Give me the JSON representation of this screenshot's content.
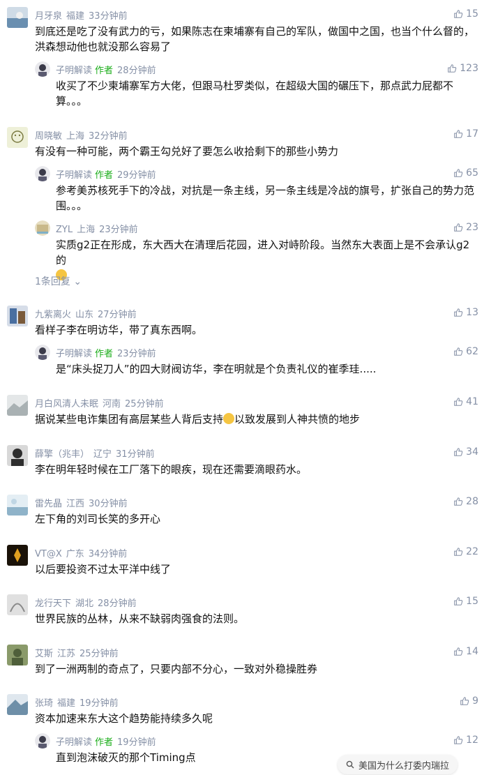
{
  "author_tag": "作者",
  "like_icon": "thumbs-up-icon",
  "comments": [
    {
      "name": "月牙泉",
      "loc": "福建",
      "time": "33分钟前",
      "text": "到底还是吃了没有武力的亏，如果陈志在柬埔寨有自己的军队，做国中之国，也当个什么督的，洪森想动他也就没那么容易了",
      "likes": "15",
      "avatar_color": "#6a8fb0"
    },
    {
      "name": "子明解读",
      "loc": "",
      "time": "28分钟前",
      "text": "收买了不少柬埔寨军方大佬，但跟马杜罗类似，在超级大国的碾压下，那点武力屁都不算。。。",
      "likes": "123",
      "avatar_color": "#3b3b4a"
    },
    {
      "name": "周晓敏",
      "loc": "上海",
      "time": "32分钟前",
      "text": "有没有一种可能，两个霸王勾兑好了要怎么收拾剩下的那些小势力",
      "likes": "17",
      "avatar_color": "#d9dcae"
    },
    {
      "name": "子明解读",
      "loc": "",
      "time": "29分钟前",
      "text": "参考美苏核死手下的冷战，对抗是一条主线，另一条主线是冷战的旗号，扩张自己的势力范围。。。",
      "likes": "65",
      "avatar_color": "#3b3b4a"
    },
    {
      "name": "ZYL",
      "loc": "上海",
      "time": "23分钟前",
      "text": "实质g2正在形成，东大西大在清理后花园，进入对峙阶段。当然东大表面上是不会承认g2的",
      "likes": "23",
      "avatar_color": "#c9b98a"
    },
    {
      "name": "九紫离火",
      "loc": "山东",
      "time": "27分钟前",
      "text": "看样子李在明访华，带了真东西啊。",
      "likes": "13",
      "avatar_color": "#4a6fa0"
    },
    {
      "name": "子明解读",
      "loc": "",
      "time": "23分钟前",
      "text": "是“床头捉刀人”的四大财阀访华，李在明就是个负责礼仪的崔季珪.....",
      "likes": "62",
      "avatar_color": "#3b3b4a"
    },
    {
      "name": "月白风清人未眠",
      "loc": "河南",
      "time": "25分钟前",
      "text_a": "据说某些电诈集团有高层某些人背后支持",
      "text_b": "以致发展到人神共愤的地步",
      "likes": "41",
      "avatar_color": "#a9b1b3"
    },
    {
      "name": "薛擎（兆丰）",
      "loc": "辽宁",
      "time": "31分钟前",
      "text": "李在明年轻时候在工厂落下的眼疾，现在还需要滴眼药水。",
      "likes": "34",
      "avatar_color": "#2e2e2e"
    },
    {
      "name": "雷先晶",
      "loc": "江西",
      "time": "30分钟前",
      "text": "左下角的刘司长笑的多开心",
      "likes": "28",
      "avatar_color": "#8fb3c9"
    },
    {
      "name": "VT@X",
      "loc": "广东",
      "time": "34分钟前",
      "text": "以后要投资不过太平洋中线了",
      "likes": "22",
      "avatar_color": "#3a2a10"
    },
    {
      "name": "龙行天下",
      "loc": "湖北",
      "time": "28分钟前",
      "text": "世界民族的丛林，从来不缺弱肉强食的法则。",
      "likes": "15",
      "avatar_color": "#b5b5b5"
    },
    {
      "name": "艾斯",
      "loc": "江苏",
      "time": "25分钟前",
      "text": "到了一洲两制的奇点了，只要内部不分心，一致对外稳操胜券",
      "likes": "14",
      "avatar_color": "#4f5f3a"
    },
    {
      "name": "张琦",
      "loc": "福建",
      "time": "19分钟前",
      "text": "资本加速来东大这个趋势能持续多久呢",
      "likes": "9",
      "avatar_color": "#6e8fa8"
    },
    {
      "name": "子明解读",
      "loc": "",
      "time": "19分钟前",
      "text": "直到泡沫破灭的那个Timing点",
      "likes": "12",
      "avatar_color": "#3b3b4a"
    }
  ],
  "more_replies": "1条回复",
  "search_suggestion": "美国为什么打委内瑞拉"
}
